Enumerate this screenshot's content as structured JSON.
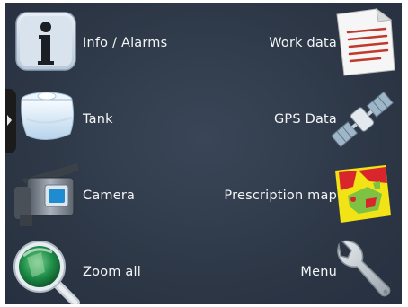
{
  "menu": {
    "left": [
      {
        "key": "info",
        "label": "Info / Alarms",
        "icon": "info-icon"
      },
      {
        "key": "tank",
        "label": "Tank",
        "icon": "tank-icon"
      },
      {
        "key": "camera",
        "label": "Camera",
        "icon": "camera-icon"
      },
      {
        "key": "zoom",
        "label": "Zoom all",
        "icon": "magnifier-icon"
      }
    ],
    "right": [
      {
        "key": "work",
        "label": "Work data",
        "icon": "document-icon"
      },
      {
        "key": "gps",
        "label": "GPS Data",
        "icon": "satellite-icon"
      },
      {
        "key": "prescription",
        "label": "Prescription map",
        "icon": "map-icon"
      },
      {
        "key": "menu",
        "label": "Menu",
        "icon": "wrench-icon"
      }
    ]
  },
  "colors": {
    "background": "#2f3a4a",
    "label_text": "#f4f6f8",
    "handle": "#1b1b1b"
  }
}
